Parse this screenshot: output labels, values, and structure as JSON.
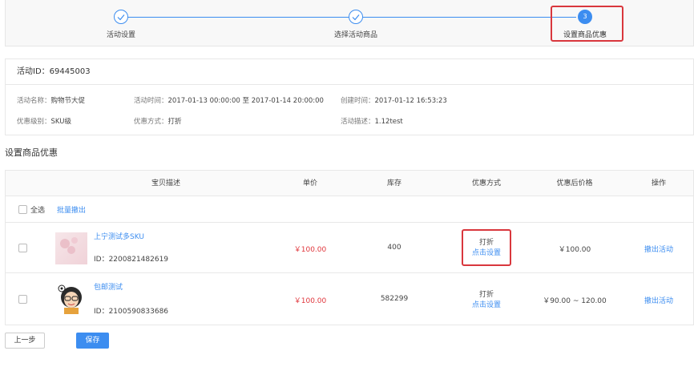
{
  "stepper": {
    "steps": [
      {
        "label": "活动设置"
      },
      {
        "label": "选择活动商品"
      },
      {
        "label": "设置商品优惠",
        "number": "3"
      }
    ]
  },
  "activity": {
    "id_label": "活动ID：",
    "id": "69445003",
    "name_label": "活动名称：",
    "name": "购物节大促",
    "time_label": "活动时间：",
    "time": "2017-01-13 00:00:00 至 2017-01-14 20:00:00",
    "created_label": "创建时间：",
    "created": "2017-01-12 16:53:23",
    "level_label": "优惠级别：",
    "level": "SKU级",
    "method_label": "优惠方式：",
    "method": "打折",
    "desc_label": "活动描述：",
    "desc": "1.12test"
  },
  "section_title": "设置商品优惠",
  "table": {
    "headers": [
      "宝贝描述",
      "单价",
      "库存",
      "优惠方式",
      "优惠后价格",
      "操作"
    ],
    "select_all": "全选",
    "batch_remove": "批量撤出",
    "rows": [
      {
        "title": "上宁测试多SKU",
        "id_text": "ID：2200821482619",
        "price": "￥100.00",
        "stock": "400",
        "discount_type": "打折",
        "discount_action": "点击设置",
        "final_price": "￥100.00",
        "operation": "撤出活动"
      },
      {
        "title": "包邮测试",
        "id_text": "ID：2100590833686",
        "price": "￥100.00",
        "stock": "582299",
        "discount_type": "打折",
        "discount_action": "点击设置",
        "final_price": "￥90.00 ~ 120.00",
        "operation": "撤出活动"
      }
    ]
  },
  "buttons": {
    "prev": "上一步",
    "save": "保存"
  },
  "colors": {
    "accent": "#3c8df0",
    "price_red": "#e0373d",
    "highlight": "#d9373d"
  }
}
